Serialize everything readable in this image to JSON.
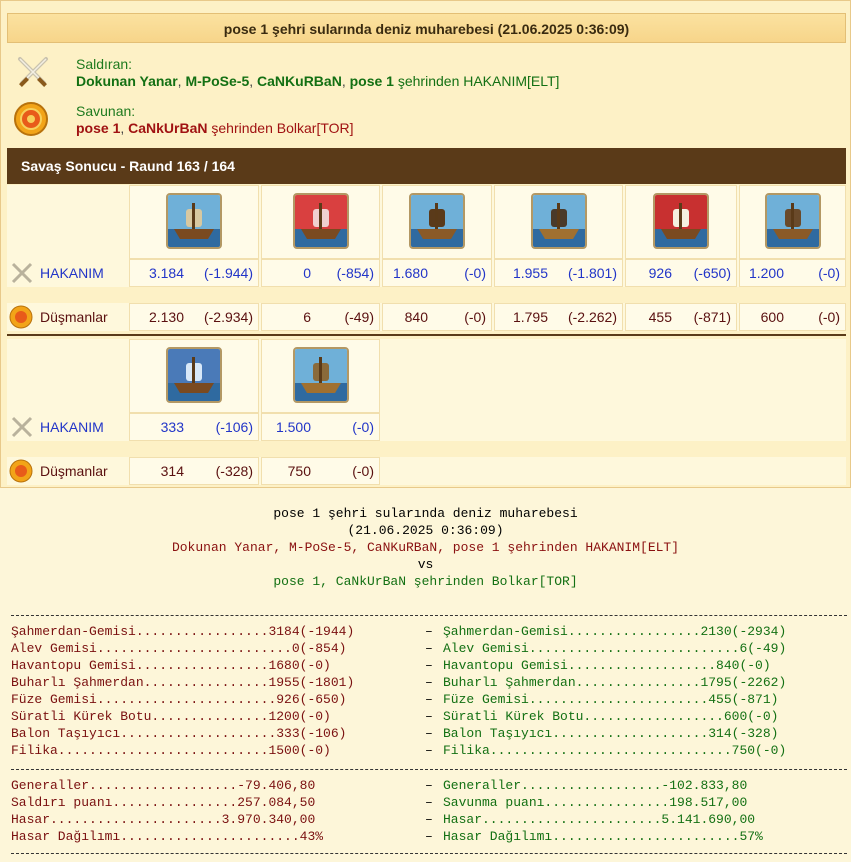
{
  "report": {
    "title": "pose 1 şehri sularında deniz muharebesi (21.06.2025 0:36:09)",
    "attacker": {
      "label": "Saldıran:",
      "names": [
        "Dokunan Yanar",
        "M-PoSe-5",
        "CaNKuRBaN",
        "pose 1"
      ],
      "suffix": "şehrinden HAKANIM[ELT]"
    },
    "defender": {
      "label": "Savunan:",
      "names": [
        "pose 1",
        "CaNkUrBaN"
      ],
      "suffix": "şehrinden Bolkar[TOR]"
    },
    "result_title": "Savaş Sonucu - Raund 163 / 164",
    "rows": {
      "own_label": "HAKANIM",
      "enemy_label": "Düşmanlar"
    },
    "block1": {
      "units": [
        "Şahmerdan-Gemisi",
        "Alev Gemisi",
        "Havantopu Gemisi",
        "Buharlı Şahmerdan",
        "Füze Gemisi",
        "Süratli Kürek Botu"
      ],
      "own": [
        [
          "3.184",
          "(-1.944)"
        ],
        [
          "0",
          "(-854)"
        ],
        [
          "1.680",
          "(-0)"
        ],
        [
          "1.955",
          "(-1.801)"
        ],
        [
          "926",
          "(-650)"
        ],
        [
          "1.200",
          "(-0)"
        ]
      ],
      "enemy": [
        [
          "2.130",
          "(-2.934)"
        ],
        [
          "6",
          "(-49)"
        ],
        [
          "840",
          "(-0)"
        ],
        [
          "1.795",
          "(-2.262)"
        ],
        [
          "455",
          "(-871)"
        ],
        [
          "600",
          "(-0)"
        ]
      ]
    },
    "block2": {
      "units": [
        "Balon Taşıyıcı",
        "Filika"
      ],
      "own": [
        [
          "333",
          "(-106)"
        ],
        [
          "1.500",
          "(-0)"
        ]
      ],
      "enemy": [
        [
          "314",
          "(-328)"
        ],
        [
          "750",
          "(-0)"
        ]
      ]
    }
  },
  "text_report": {
    "title": "pose 1 şehri sularında deniz muharebesi",
    "date": "(21.06.2025 0:36:09)",
    "attacker_line": "Dokunan Yanar, M-PoSe-5, CaNKuRBaN, pose 1 şehrinden HAKANIM[ELT]",
    "vs": "vs",
    "defender_line": "pose 1, CaNkUrBaN şehrinden Bolkar[TOR]",
    "unit_lines": [
      [
        "Şahmerdan-Gemisi.................3184(-1944)",
        "Şahmerdan-Gemisi.................2130(-2934)"
      ],
      [
        "Alev Gemisi.........................0(-854)",
        "Alev Gemisi...........................6(-49)"
      ],
      [
        "Havantopu Gemisi.................1680(-0)",
        "Havantopu Gemisi...................840(-0)"
      ],
      [
        "Buharlı Şahmerdan................1955(-1801)",
        "Buharlı Şahmerdan................1795(-2262)"
      ],
      [
        "Füze Gemisi.......................926(-650)",
        "Füze Gemisi.......................455(-871)"
      ],
      [
        "Süratli Kürek Botu...............1200(-0)",
        "Süratli Kürek Botu..................600(-0)"
      ],
      [
        "Balon Taşıyıcı....................333(-106)",
        "Balon Taşıyıcı....................314(-328)"
      ],
      [
        "Filika...........................1500(-0)",
        "Filika...............................750(-0)"
      ]
    ],
    "summary_lines": [
      [
        "Generaller...................-79.406,80",
        "Generaller..................-102.833,80"
      ],
      [
        "Saldırı puanı................257.084,50",
        "Savunma puanı................198.517,00"
      ],
      [
        "Hasar......................3.970.340,00",
        "Hasar.......................5.141.690,00"
      ],
      [
        "Hasar Dağılımı.......................43%",
        "Hasar Dağılımı........................57%"
      ]
    ],
    "separator": "–"
  },
  "colors": {
    "brown_bar": "#5a3a18",
    "attacker_green": "#137013",
    "defender_red": "#a01212",
    "own_blue": "#2235c8"
  }
}
